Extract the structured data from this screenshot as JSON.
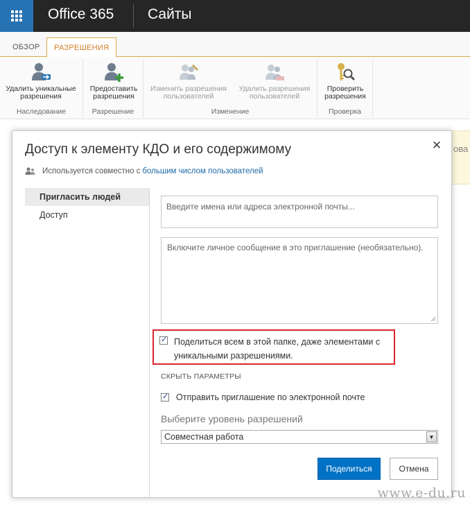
{
  "suite_bar": {
    "brand": "Office 365",
    "site_title": "Сайты"
  },
  "ribbon": {
    "tabs": [
      {
        "label": "Обзор"
      },
      {
        "label": "Разрешения"
      }
    ],
    "groups": [
      {
        "label": "Наследование",
        "buttons": [
          {
            "label": "Удалить уникальные разрешения",
            "icon": "user-remove-icon",
            "enabled": true
          }
        ]
      },
      {
        "label": "Разрешение",
        "buttons": [
          {
            "label": "Предоставить разрешения",
            "icon": "user-add-icon",
            "enabled": true
          }
        ]
      },
      {
        "label": "Изменение",
        "buttons": [
          {
            "label": "Изменить разрешения пользователей",
            "icon": "users-edit-icon",
            "enabled": false
          },
          {
            "label": "Удалить разрешения пользователей",
            "icon": "users-remove-icon",
            "enabled": false
          }
        ]
      },
      {
        "label": "Проверка",
        "buttons": [
          {
            "label": "Проверить разрешения",
            "icon": "key-search-icon",
            "enabled": true
          }
        ]
      }
    ]
  },
  "background": {
    "banner_fragment": "ова"
  },
  "dialog": {
    "title": "Доступ к элементу КДО и его содержимому",
    "shared_prefix": "Используется совместно с",
    "shared_link": "большим числом пользователей",
    "nav": [
      {
        "label": "Пригласить людей",
        "active": true
      },
      {
        "label": "Доступ",
        "active": false
      }
    ],
    "invite_placeholder": "Введите имена или адреса электронной почты...",
    "message_placeholder": "Включите личное сообщение в это приглашение (необязательно).",
    "share_all_checked": true,
    "share_all_label": "Поделиться всем в этой папке, даже элементами с уникальными разрешениями.",
    "hide_options": "Скрыть параметры",
    "send_email_checked": true,
    "send_email_label": "Отправить приглашение по электронной почте",
    "permission_level_label": "Выберите уровень разрешений",
    "permission_level_value": "Совместная работа",
    "share_button": "Поделиться",
    "cancel_button": "Отмена"
  },
  "watermark": "www.e-du.ru",
  "colors": {
    "suite_bar": "#262626",
    "waffle": "#2672b2",
    "tab_accent": "#d8a94a",
    "primary_button": "#0072c6",
    "highlight": "#d9262c",
    "link": "#1e6ba8"
  }
}
